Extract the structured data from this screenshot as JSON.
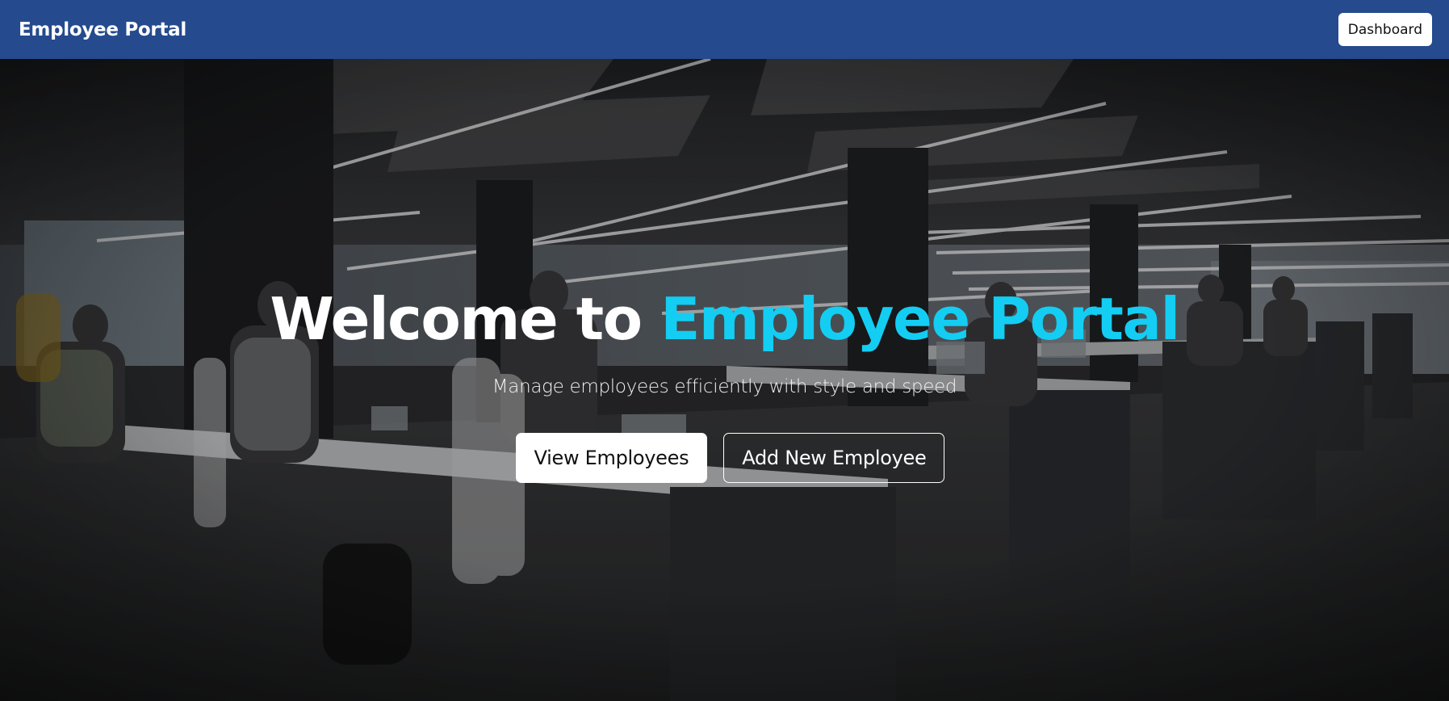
{
  "navbar": {
    "brand": "Employee Portal",
    "dashboard_label": "Dashboard"
  },
  "hero": {
    "title_prefix": "Welcome to ",
    "title_accent": "Employee Portal",
    "subtitle": "Manage employees efficiently with style and speed",
    "primary_button": "View Employees",
    "secondary_button": "Add New Employee",
    "background": "office-workspace-photo"
  },
  "colors": {
    "navbar": "#254a8e",
    "accent": "#13cdf3",
    "white": "#ffffff"
  }
}
